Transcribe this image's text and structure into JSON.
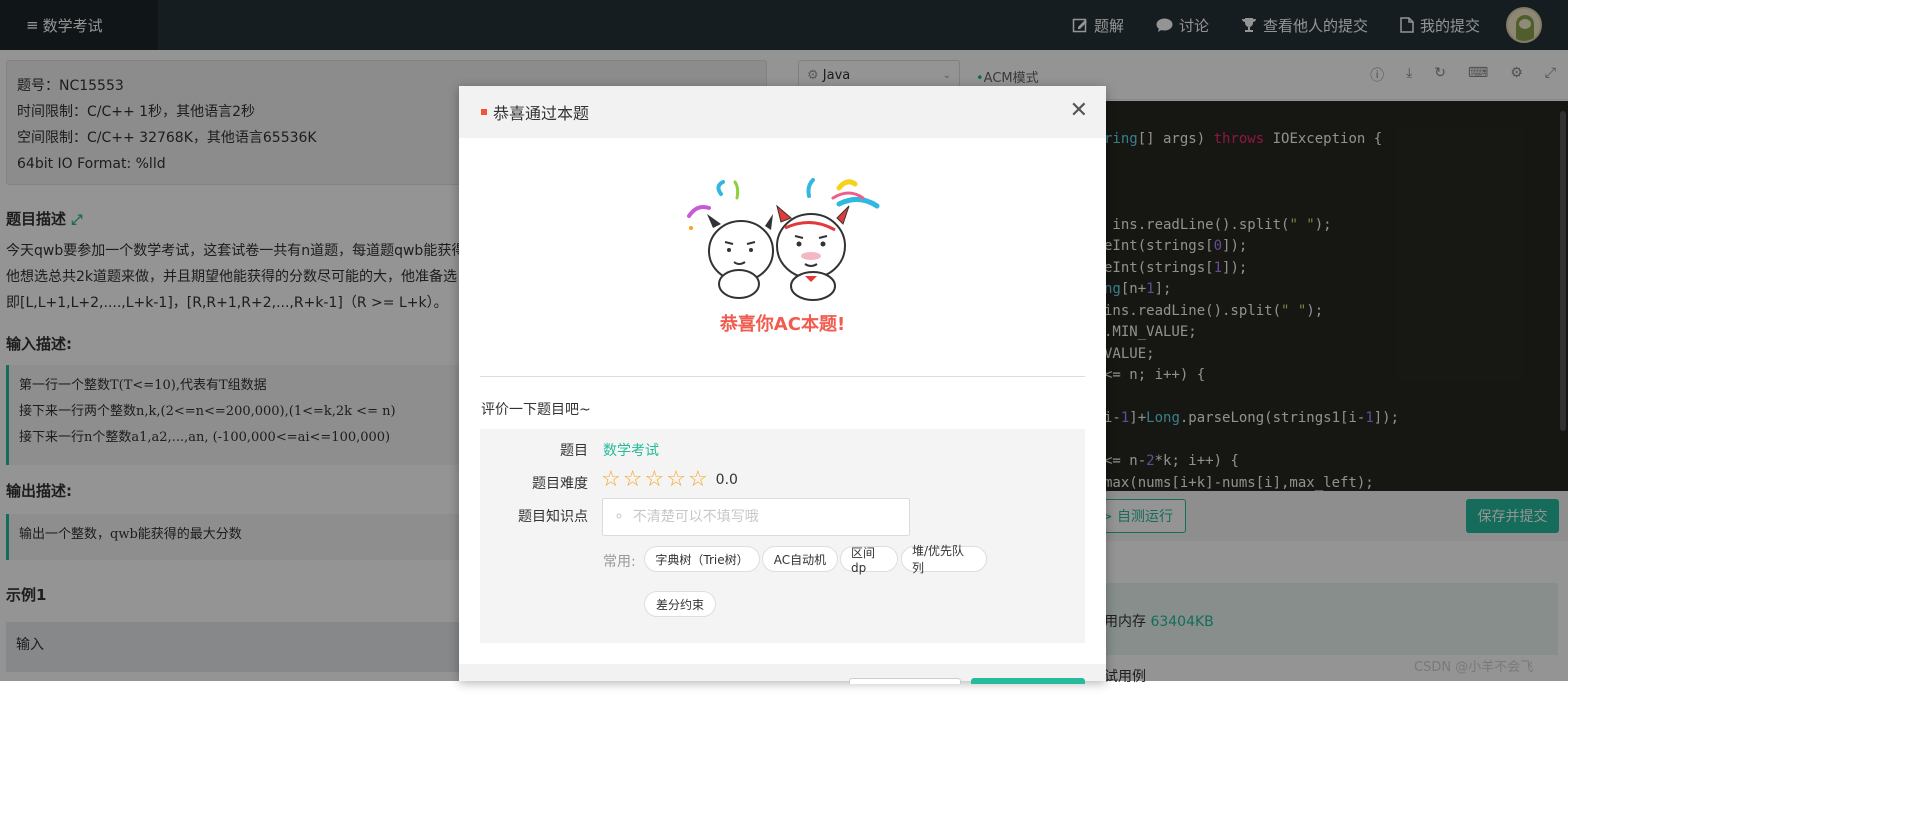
{
  "topbar": {
    "title": "数学考试",
    "nav": [
      "题解",
      "讨论",
      "查看他人的提交",
      "我的提交"
    ]
  },
  "problem": {
    "info": [
      "题号：NC15553",
      "时间限制：C/C++ 1秒，其他语言2秒",
      "空间限制：C/C++ 32768K，其他语言65536K",
      "64bit IO Format: %lld"
    ],
    "desc_title": "题目描述",
    "desc_lines": [
      "今天qwb要参加一个数学考试，这套试卷一共有n道题，每道题qwb能获得",
      "他想选总共2k道题来做，并且期望他能获得的分数尽可能的大，他准备选",
      "即[L,L+1,L+2,....,L+k-1]，[R,R+1,R+2,...,R+k-1]（R >= L+k）。"
    ],
    "input_title": "输入描述:",
    "input_lines": [
      "第一行一个整数T(T<=10),代表有T组数据",
      "接下来一行两个整数n,k,(2<=n<=200,000),(1<=k,2k <= n)",
      "接下来一行n个整数a1,a2,...,an, (-100,000<=ai<=100,000)"
    ],
    "output_title": "输出描述:",
    "output_line": "输出一个整数，qwb能获得的最大分数",
    "example_title": "示例1",
    "example_input": "输入"
  },
  "editor": {
    "language": "Java",
    "mode": "ACM模式",
    "code_lines": [
      {
        "text": "ring[] args) throws IOException {"
      },
      {
        "text": " ins.readLine().split(\" \");"
      },
      {
        "text": "eInt(strings[0]);"
      },
      {
        "text": "eInt(strings[1]);"
      },
      {
        "text": "ng[n+1];"
      },
      {
        "text": "ins.readLine().split(\" \");"
      },
      {
        "text": ".MIN_VALUE;"
      },
      {
        "text": "VALUE;"
      },
      {
        "text": "<= n; i++) {"
      },
      {
        "text": "i-1]+Long.parseLong(strings1[i-1]);"
      },
      {
        "text": "<= n-2*k; i++) {"
      },
      {
        "text": "max(nums[i+k]-nums[i],max_left);"
      }
    ],
    "selftest_label": "> 自测运行",
    "submit_label": "保存并提交",
    "memory_label": "用内存",
    "memory_value": "63404KB",
    "testcase_label": "试用例"
  },
  "modal": {
    "title": "恭喜通过本题",
    "congrats": "恭喜你AC本题!",
    "rate_title": "评价一下题目吧~",
    "problem_label": "题目",
    "problem_name": "数学考试",
    "difficulty_label": "题目难度",
    "difficulty_score": "0.0",
    "stars_filled": 0,
    "stars_total": 5,
    "knowledge_label": "题目知识点",
    "tag_placeholder": "不清楚可以不填写哦",
    "common_label": "常用:",
    "chips": [
      "字典树（Trie树）",
      "AC自动机",
      "区间dp",
      "堆/优先队列",
      "差分约束"
    ]
  },
  "watermark": "CSDN @小羊不会飞",
  "colors": {
    "accent": "#25bb9b",
    "congrats": "#f05d50",
    "star": "#f5a623",
    "topbar": "#263238"
  }
}
